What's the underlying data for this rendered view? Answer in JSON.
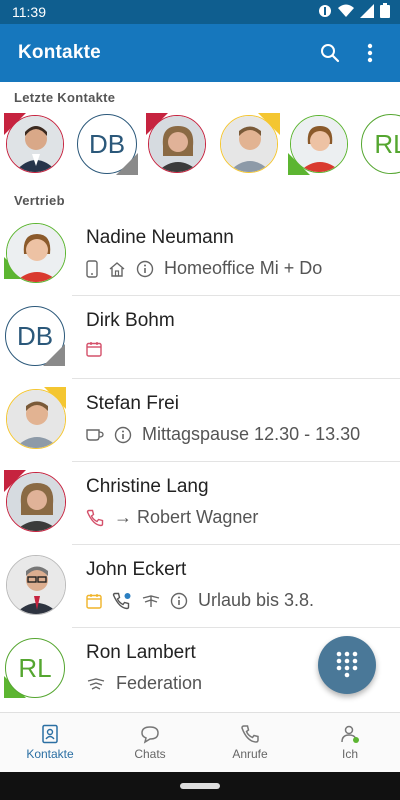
{
  "status": {
    "time": "11:39"
  },
  "appbar": {
    "title": "Kontakte"
  },
  "sections": {
    "recent": "Letzte Kontakte",
    "group": "Vertrieb"
  },
  "recent": [
    {
      "initials": ""
    },
    {
      "initials": "DB"
    },
    {
      "initials": ""
    },
    {
      "initials": ""
    },
    {
      "initials": ""
    },
    {
      "initials": "RL"
    }
  ],
  "contacts": [
    {
      "name": "Nadine Neumann",
      "status": "Homeoffice Mi + Do"
    },
    {
      "name": "Dirk Bohm",
      "initials": "DB",
      "status": ""
    },
    {
      "name": "Stefan Frei",
      "status": "Mittagspause 12.30 - 13.30"
    },
    {
      "name": "Christine Lang",
      "status": "→ Robert Wagner"
    },
    {
      "name": "John Eckert",
      "status": "Urlaub bis 3.8."
    },
    {
      "name": "Ron Lambert",
      "initials": "RL",
      "status": "Federation"
    }
  ],
  "nav": [
    {
      "label": "Kontakte"
    },
    {
      "label": "Chats"
    },
    {
      "label": "Anrufe"
    },
    {
      "label": "Ich"
    }
  ],
  "colors": {
    "primary": "#1677bd",
    "statusbar": "#0f5e8f",
    "presence_green": "#5cb531",
    "presence_red": "#c6233f",
    "presence_yellow": "#f4c631",
    "fab": "#4a7898"
  }
}
